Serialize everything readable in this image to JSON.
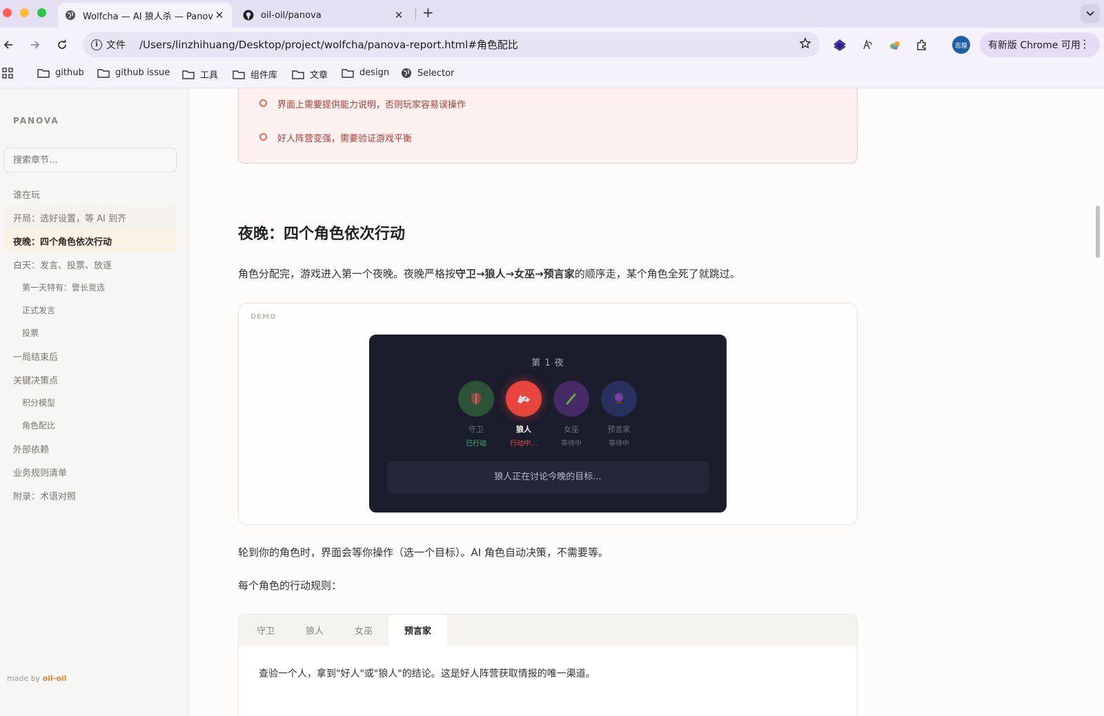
{
  "browser": {
    "tabs": [
      {
        "title": "Wolfcha — AI 狼人杀 — Panova",
        "active": true,
        "icon": "globe-icon"
      },
      {
        "title": "oil-oil/panova",
        "active": false,
        "icon": "github-icon"
      }
    ],
    "omnibox": {
      "scheme_label": "文件",
      "url": "/Users/linzhihuang/Desktop/project/wolfcha/panova-report.html#角色配比"
    },
    "profile_label": "志煌",
    "update_button": "有新版 Chrome 可用",
    "bookmarks": [
      "github",
      "github issue",
      "工具",
      "组件库",
      "文章",
      "design",
      "Selector"
    ]
  },
  "sidebar": {
    "brand": "PANOVA",
    "search_placeholder": "搜索章节...",
    "items": [
      {
        "label": "谁在玩",
        "level": 1
      },
      {
        "label": "开局：选好设置，等 AI 到齐",
        "level": 1
      },
      {
        "label": "夜晚：四个角色依次行动",
        "level": 1,
        "active": true
      },
      {
        "label": "白天：发言、投票、放逐",
        "level": 1
      },
      {
        "label": "第一天特有：警长竞选",
        "level": 2
      },
      {
        "label": "正式发言",
        "level": 2
      },
      {
        "label": "投票",
        "level": 2
      },
      {
        "label": "一局结束后",
        "level": 1
      },
      {
        "label": "关键决策点",
        "level": 1
      },
      {
        "label": "积分模型",
        "level": 2
      },
      {
        "label": "角色配比",
        "level": 2
      },
      {
        "label": "外部依赖",
        "level": 1
      },
      {
        "label": "业务规则清单",
        "level": 1
      },
      {
        "label": "附录：术语对照",
        "level": 1
      }
    ],
    "made_by_prefix": "made by ",
    "made_by_author": "oil-oil"
  },
  "content": {
    "warnings": [
      "界面上需要提供能力说明，否则玩家容易误操作",
      "好人阵营变强，需要验证游戏平衡"
    ],
    "section_title": "夜晚：四个角色依次行动",
    "intro": {
      "before": "角色分配完，游戏进入第一个夜晚。夜晚严格按",
      "bold": "守卫→狼人→女巫→预言家",
      "after": "的顺序走，某个角色全死了就跳过。"
    },
    "demo": {
      "label": "DEMO",
      "night_title": "第 1 夜",
      "roles": [
        {
          "name": "守卫",
          "status": "已行动",
          "state": "done",
          "color": "#2f5a3a",
          "icon": "shield-icon"
        },
        {
          "name": "狼人",
          "status": "行动中...",
          "state": "active",
          "color": "#e8453c",
          "icon": "wolf-icon"
        },
        {
          "name": "女巫",
          "status": "等待中",
          "state": "waiting",
          "color": "#4b2e6e",
          "icon": "potion-icon"
        },
        {
          "name": "预言家",
          "status": "等待中",
          "state": "waiting",
          "color": "#2a3668",
          "icon": "crystal-ball-icon"
        }
      ],
      "message": "狼人正在讨论今晚的目标..."
    },
    "para2": "轮到你的角色时，界面会等你操作（选一个目标）。AI 角色自动决策，不需要等。",
    "para3": "每个角色的行动规则：",
    "role_tabs": [
      "守卫",
      "狼人",
      "女巫",
      "预言家"
    ],
    "active_role_tab": "预言家",
    "tab_description": "查验一个人，拿到\"好人\"或\"狼人\"的结论。这是好人阵营获取情报的唯一渠道。"
  }
}
